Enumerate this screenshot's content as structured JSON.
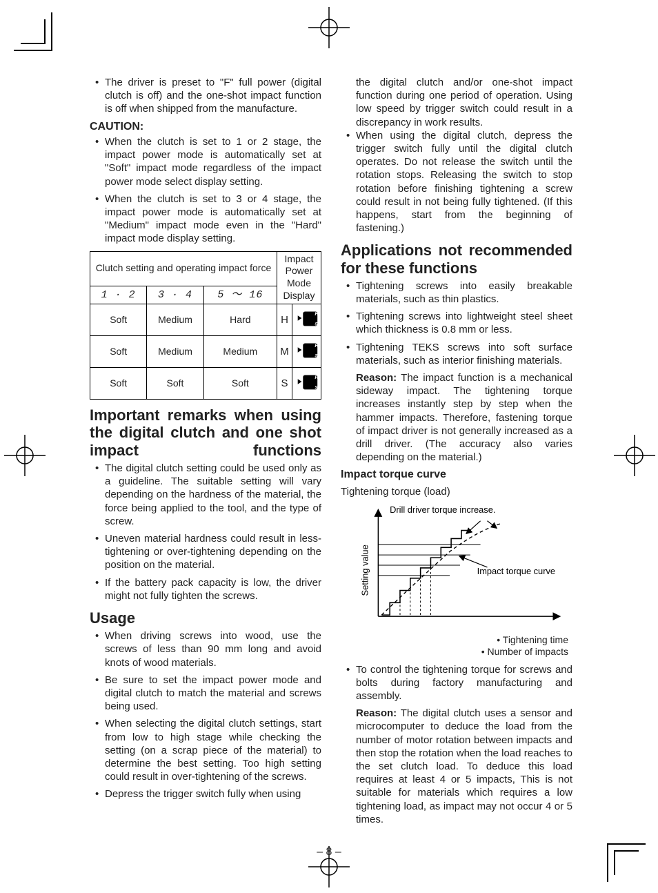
{
  "page_number": "8",
  "col1": {
    "preset_note": "The driver is preset to \"F\" full power (digital clutch is off) and the one-shot impact function is off when shipped from the manufacture.",
    "caution_label": "CAUTION:",
    "caution_items": [
      "When the clutch is set to 1 or 2 stage, the impact power mode is automatically set at \"Soft\" impact mode regardless of the impact power mode select display setting.",
      "When the clutch is set to 3 or 4 stage, the impact power mode is automatically set at \"Medium\" impact mode even in the \"Hard\" impact mode display setting."
    ],
    "table": {
      "header_left": "Clutch setting and operating impact force",
      "header_right": "Impact Power Mode Display",
      "ranges": [
        "1 · 2",
        "3 · 4",
        "5 ～ 16"
      ],
      "rows": [
        {
          "cells": [
            "Soft",
            "Medium",
            "Hard"
          ],
          "mode": "H"
        },
        {
          "cells": [
            "Soft",
            "Medium",
            "Medium"
          ],
          "mode": "M"
        },
        {
          "cells": [
            "Soft",
            "Soft",
            "Soft"
          ],
          "mode": "S"
        }
      ]
    },
    "remarks_heading": "Important remarks when using the digital clutch and one shot impact functions",
    "remarks_items": [
      "The digital clutch setting could be used only as a guideline. The suitable setting will vary depending on the hardness of the material, the force being applied to the tool, and the type of screw.",
      "Uneven material hardness could result in less-tightening or over-tightening depending on the position on the material.",
      "If the battery pack capacity is low, the driver might not fully tighten the screws."
    ],
    "usage_heading": "Usage",
    "usage_items": [
      "When driving screws into wood, use the screws of less than 90 mm long and avoid knots of wood materials.",
      "Be sure to set the impact power mode and digital clutch to match the material and screws being used.",
      "When selecting the digital clutch settings, start from low to high stage while checking the setting (on a scrap piece of the material) to determine the best setting. Too high setting could result in over-tightening of the screws.",
      "Depress the trigger switch fully when using"
    ]
  },
  "col2": {
    "cont_items": [
      "the digital clutch and/or one-shot impact function during one period of operation. Using low speed by trigger switch could result in a discrepancy in work results.",
      "When using the digital clutch, depress the trigger switch fully until the digital clutch operates. Do not release the switch until the rotation stops. Releasing the switch to stop rotation before finishing tightening a screw could result in not being fully tightened. (If this happens, start from the beginning of fastening.)"
    ],
    "apps_heading": "Applications not recommended for these functions",
    "apps_items": [
      "Tightening screws into easily breakable materials, such as thin plastics.",
      "Tightening screws into lightweight steel sheet which thickness is 0.8 mm or less.",
      "Tightening TEKS screws into soft surface materials, such as interior finishing materials."
    ],
    "reason1_label": "Reason:",
    "reason1_text": " The impact function is a mechanical sideway impact. The tightening torque increases instantly step by step when the hammer impacts. Therefore, fastening torque of impact driver is not generally increased as a drill driver. (The accuracy also varies depending on the material.)",
    "curve_heading": "Impact torque curve",
    "curve_subtitle": "Tightening torque (load)",
    "curve_labels": {
      "y_label": "Setting value",
      "drill_label": "Drill driver torque increase.",
      "impact_label": "Impact torque curve",
      "axis_notes": [
        "• Tightening time",
        "• Number of impacts"
      ]
    },
    "control_item": "To control the tightening torque for screws and bolts during factory manufacturing and assembly.",
    "reason2_label": "Reason:",
    "reason2_text": " The digital clutch uses a sensor and microcomputer to deduce the load from the number of motor rotation between impacts and then stop the rotation when the load reaches to the set clutch load. To deduce this load requires at least 4 or 5 impacts, This is not suitable for materials which requires a low tightening load, as impact may not occur 4 or 5 times."
  },
  "chart_data": {
    "type": "line",
    "title": "Impact torque curve",
    "xlabel": "Tightening time / Number of impacts",
    "ylabel": "Setting value (Tightening torque / load)",
    "description": "Qualitative comparison: impact driver torque rises in discrete steps per impact; drill driver torque rises as a smooth dashed curve above it. Horizontal reference lines mark several setting values.",
    "series": [
      {
        "name": "Impact torque curve",
        "style": "stepped-solid",
        "x": [
          0,
          1,
          1,
          2,
          2,
          3,
          3,
          4,
          4,
          5,
          5,
          6,
          6,
          7,
          7,
          8
        ],
        "y": [
          0,
          0,
          1,
          1,
          2,
          2,
          3,
          3,
          4,
          4,
          5,
          5,
          6,
          6,
          7,
          7
        ]
      },
      {
        "name": "Drill driver torque increase",
        "style": "dashed",
        "x": [
          0,
          1,
          2,
          3,
          4,
          5,
          6,
          7,
          8
        ],
        "y": [
          0,
          1.3,
          2.5,
          3.6,
          4.6,
          5.5,
          6.3,
          7.0,
          7.6
        ]
      }
    ],
    "reference_lines_y": [
      3,
      4,
      5,
      6
    ],
    "xlim": [
      0,
      9
    ],
    "ylim": [
      0,
      9
    ]
  }
}
